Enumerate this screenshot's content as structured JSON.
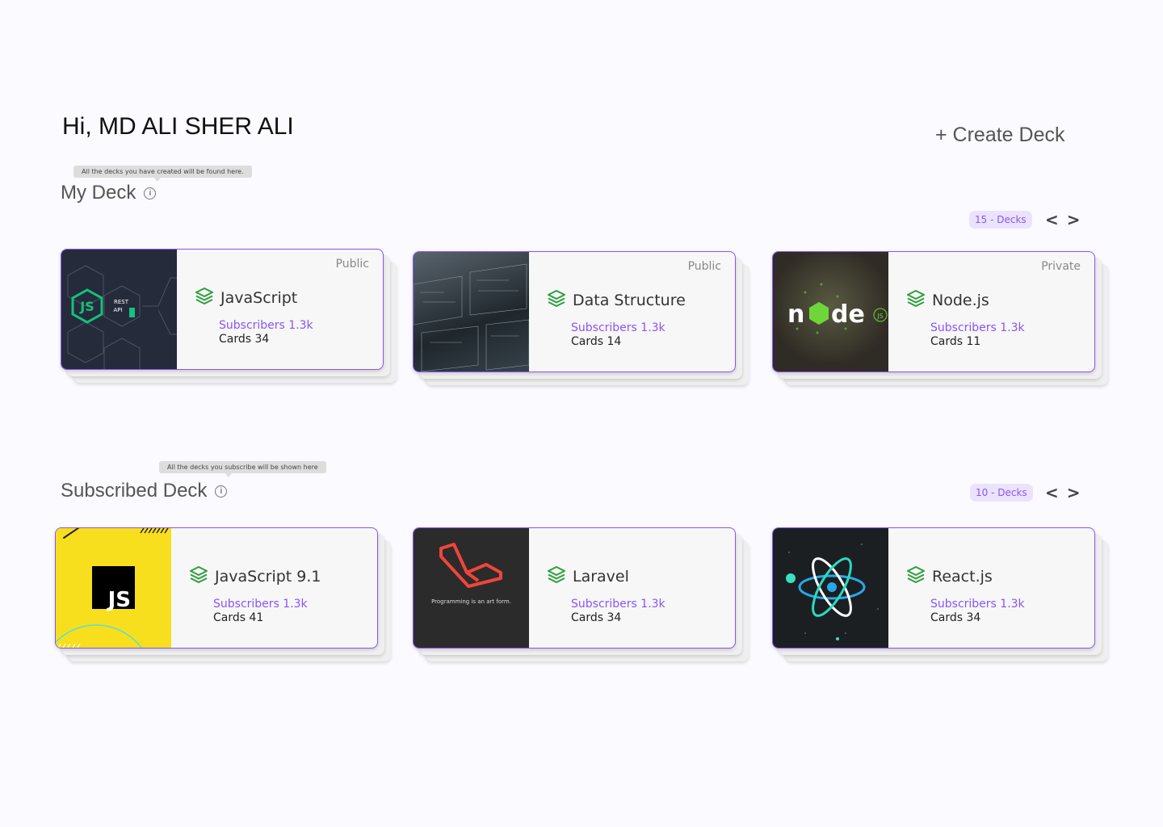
{
  "greeting": "Hi, MD ALI SHER ALI",
  "create_label": "+ Create Deck",
  "my_deck": {
    "title": "My Deck",
    "tooltip": "All the decks you have created will be found here.",
    "count_badge": "15 - Decks",
    "prev": "<",
    "next": ">",
    "cards": [
      {
        "title": "JavaScript",
        "visibility": "Public",
        "subscribers": "Subscribers 1.3k",
        "cards": "Cards 34",
        "thumb": "js-rest-api"
      },
      {
        "title": "Data Structure",
        "visibility": "Public",
        "subscribers": "Subscribers 1.3k",
        "cards": "Cards 14",
        "thumb": "math-boards"
      },
      {
        "title": "Node.js",
        "visibility": "Private",
        "subscribers": "Subscribers 1.3k",
        "cards": "Cards 11",
        "thumb": "node-logo"
      }
    ]
  },
  "subscribed_deck": {
    "title": "Subscribed Deck",
    "tooltip": "All the decks you subscribe will be shown here",
    "count_badge": "10 - Decks",
    "prev": "<",
    "next": ">",
    "cards": [
      {
        "title": "JavaScript 9.1",
        "subscribers": "Subscribers 1.3k",
        "cards": "Cards 41",
        "thumb": "js-yellow"
      },
      {
        "title": "Laravel",
        "subscribers": "Subscribers 1.3k",
        "cards": "Cards 34",
        "thumb": "laravel",
        "thumb_caption": "Programming is an art form."
      },
      {
        "title": "React.js",
        "subscribers": "Subscribers 1.3k",
        "cards": "Cards 34",
        "thumb": "react-atom"
      }
    ]
  },
  "colors": {
    "accent": "#8a55f5",
    "deck_icon": "#2e9e3e",
    "background": "#fafaff"
  }
}
